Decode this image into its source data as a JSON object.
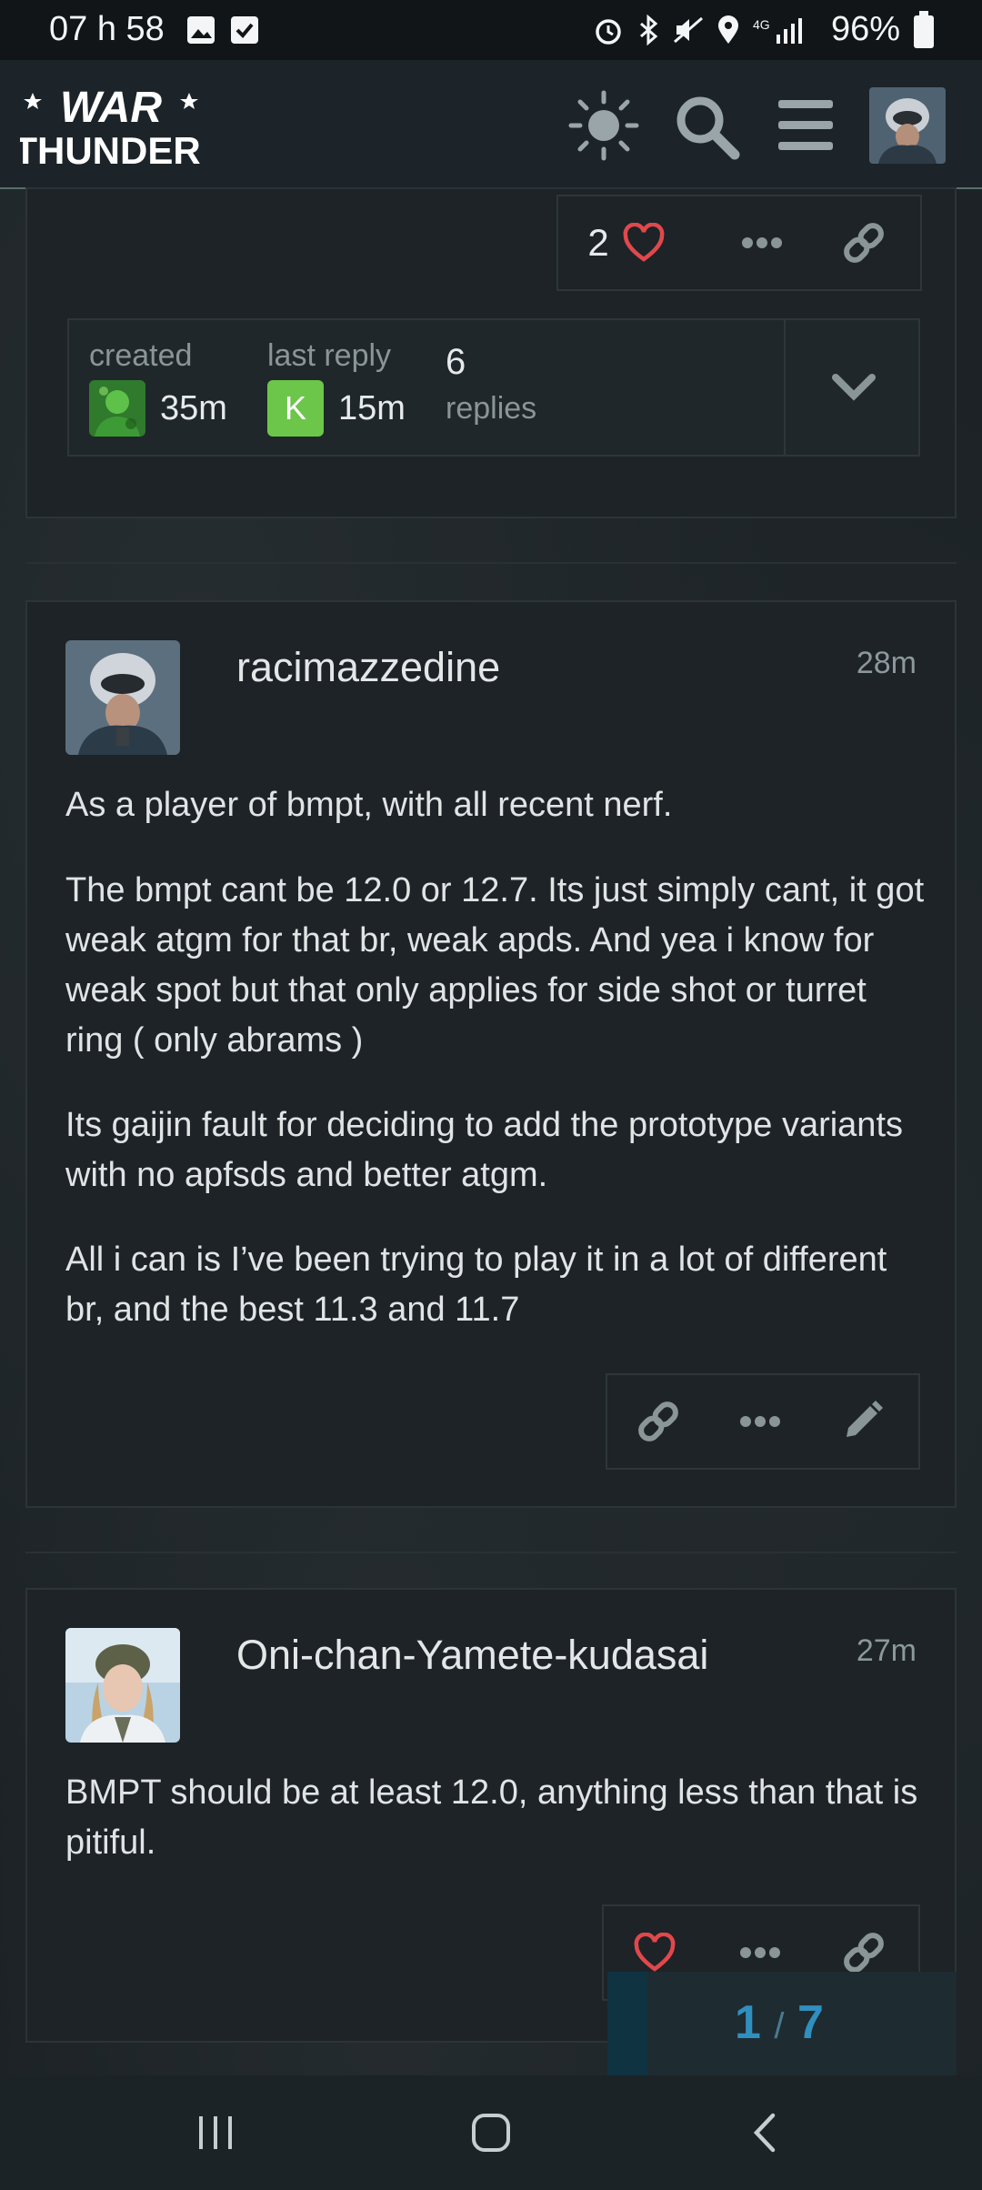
{
  "status_bar": {
    "time": "07 h 58",
    "battery": "96%"
  },
  "header": {
    "logo_text_top": "WAR",
    "logo_text_bottom": "THUNDER"
  },
  "topic_footer": {
    "like_count": "2",
    "created_label": "created",
    "created_time": "35m",
    "last_reply_label": "last reply",
    "last_reply_avatar_letter": "K",
    "last_reply_time": "15m",
    "replies_count": "6",
    "replies_label": "replies"
  },
  "posts": [
    {
      "username": "racimazzedine",
      "time": "28m",
      "paragraphs": [
        "As a player of bmpt, with all recent nerf.",
        "The bmpt cant be 12.0 or 12.7. Its just simply cant, it got weak atgm for that br, weak apds. And yea i know for weak spot but that only applies for side shot or turret ring ( only abrams )",
        "Its gaijin fault for deciding to add the prototype variants with no apfsds and better atgm.",
        "All i can is I’ve been trying to play it in a lot of different br, and the best 11.3 and 11.7"
      ]
    },
    {
      "username": "Oni-chan-Yamete-kudasai",
      "time": "27m",
      "paragraphs": [
        "BMPT should be at least 12.0, anything less than that is pitiful."
      ]
    }
  ],
  "progress": {
    "current": "1",
    "separator": "/",
    "total": "7"
  },
  "colors": {
    "like_red": "#e0484b",
    "accent_blue": "#2f8fbf",
    "avatar_k": "#6cc64a"
  }
}
